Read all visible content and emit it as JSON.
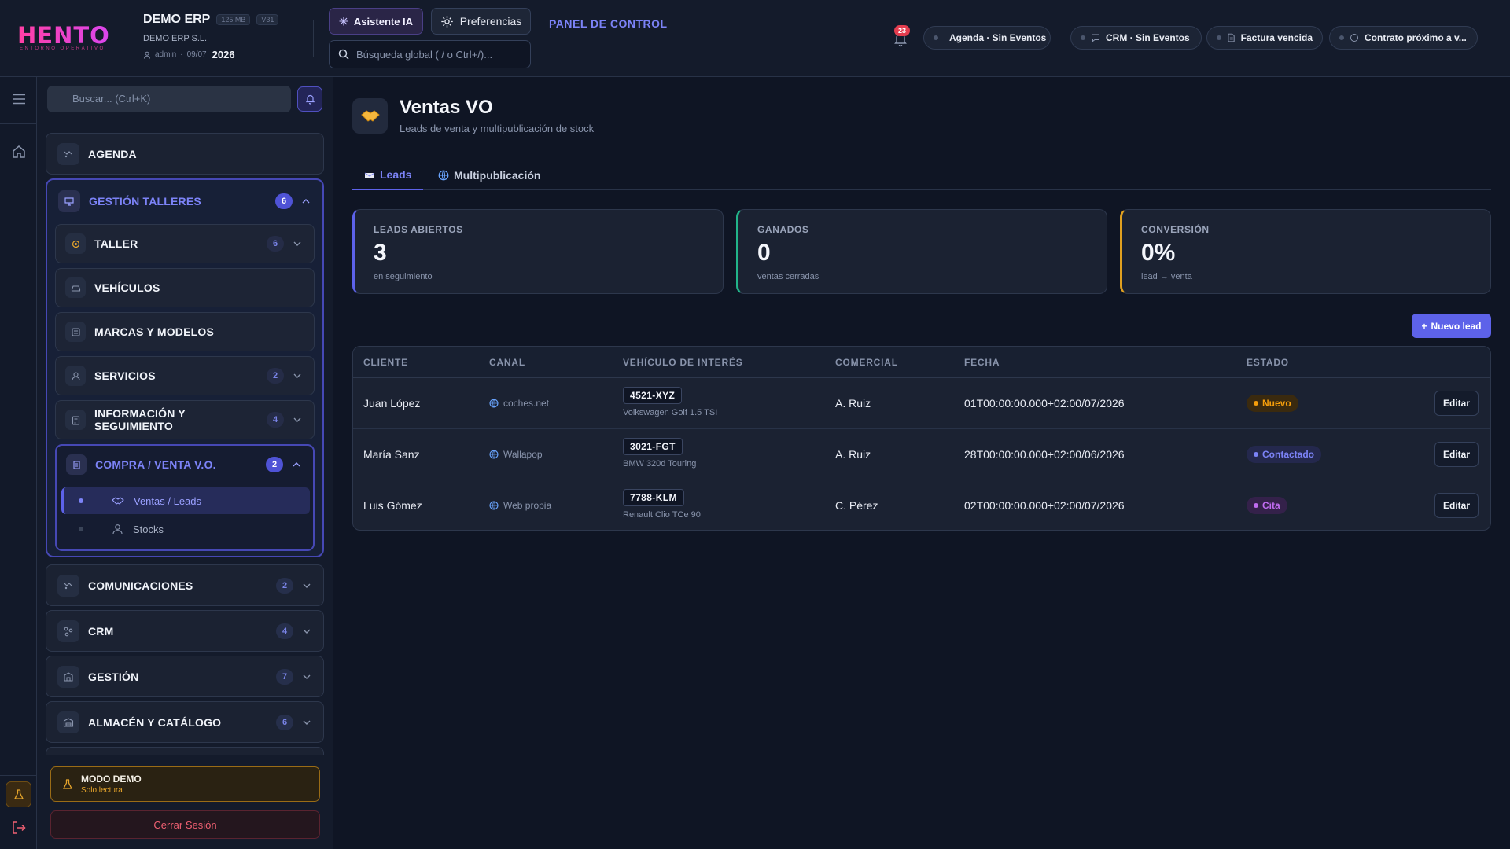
{
  "header": {
    "logo_text": "HENTOP",
    "logo_subtitle": "ENTORNO OPERATIVO",
    "company_name": "DEMO ERP",
    "size_badge": "125 MB",
    "version_badge": "V31",
    "company_legal": "DEMO ERP S.L.",
    "user": "admin",
    "date": "09/07",
    "year": "2026",
    "ai_button": "Asistente IA",
    "preferences_button": "Preferencias",
    "search_placeholder": "Búsqueda global ( / o Ctrl+/)...",
    "panel_title": "PANEL DE CONTROL",
    "panel_value": "—",
    "notification_count": "23",
    "pills": [
      {
        "label": "Agenda · Sin Eventos",
        "icon": "calendar-icon"
      },
      {
        "label": "CRM · Sin Eventos",
        "icon": "chat-icon"
      },
      {
        "label": "Factura vencida",
        "icon": "document-icon"
      },
      {
        "label": "Contrato próximo a v...",
        "icon": "message-icon"
      }
    ]
  },
  "sidebar": {
    "search_placeholder": "Buscar... (Ctrl+K)",
    "items": [
      {
        "label": "AGENDA",
        "count": ""
      },
      {
        "label": "GESTIÓN TALLERES",
        "count": "6"
      },
      {
        "label": "COMUNICACIONES",
        "count": "2"
      },
      {
        "label": "CRM",
        "count": "4"
      },
      {
        "label": "GESTIÓN",
        "count": "7"
      },
      {
        "label": "ALMACÉN Y CATÁLOGO",
        "count": "6"
      }
    ],
    "sub_items": [
      {
        "label": "TALLER",
        "count": "6"
      },
      {
        "label": "VEHÍCULOS",
        "count": ""
      },
      {
        "label": "MARCAS Y MODELOS",
        "count": ""
      },
      {
        "label": "SERVICIOS",
        "count": "2"
      },
      {
        "label": "INFORMACIÓN Y SEGUIMIENTO",
        "count": "4"
      }
    ],
    "open_subgroup": {
      "label": "COMPRA / VENTA V.O.",
      "count": "2"
    },
    "leaves": [
      {
        "label": "Ventas / Leads",
        "active": true
      },
      {
        "label": "Stocks",
        "active": false
      }
    ],
    "demo_title": "MODO DEMO",
    "demo_subtitle": "Solo lectura",
    "logout": "Cerrar Sesión"
  },
  "page": {
    "title": "Ventas VO",
    "subtitle": "Leads de venta y multipublicación de stock",
    "tabs": [
      {
        "label": "Leads",
        "active": true
      },
      {
        "label": "Multipublicación",
        "active": false
      }
    ],
    "stats": [
      {
        "label": "LEADS ABIERTOS",
        "value": "3",
        "hint": "en seguimiento",
        "color": "#5d62e9"
      },
      {
        "label": "GANADOS",
        "value": "0",
        "hint": "ventas cerradas",
        "color": "#22b48a"
      },
      {
        "label": "CONVERSIÓN",
        "value": "0%",
        "hint": "lead → venta",
        "color": "#e0a020"
      }
    ],
    "new_lead_button": "Nuevo lead"
  },
  "table": {
    "headers": [
      "CLIENTE",
      "CANAL",
      "VEHÍCULO DE INTERÉS",
      "COMERCIAL",
      "FECHA",
      "ESTADO"
    ],
    "rows": [
      {
        "cliente": "Juan López",
        "canal": "coches.net",
        "matricula": "4521-XYZ",
        "modelo": "Volkswagen Golf 1.5 TSI",
        "comercial": "A. Ruiz",
        "fecha": "01T00:00:00.000+02:00/07/2026",
        "estado": "Nuevo",
        "estado_color": "#f59e0b"
      },
      {
        "cliente": "María Sanz",
        "canal": "Wallapop",
        "matricula": "3021-FGT",
        "modelo": "BMW 320d Touring",
        "comercial": "A. Ruiz",
        "fecha": "28T00:00:00.000+02:00/06/2026",
        "estado": "Contactado",
        "estado_color": "#7c83f7"
      },
      {
        "cliente": "Luis Gómez",
        "canal": "Web propia",
        "matricula": "7788-KLM",
        "modelo": "Renault Clio TCe 90",
        "comercial": "C. Pérez",
        "fecha": "02T00:00:00.000+02:00/07/2026",
        "estado": "Cita",
        "estado_color": "#c06cf0"
      }
    ],
    "edit_label": "Editar"
  }
}
